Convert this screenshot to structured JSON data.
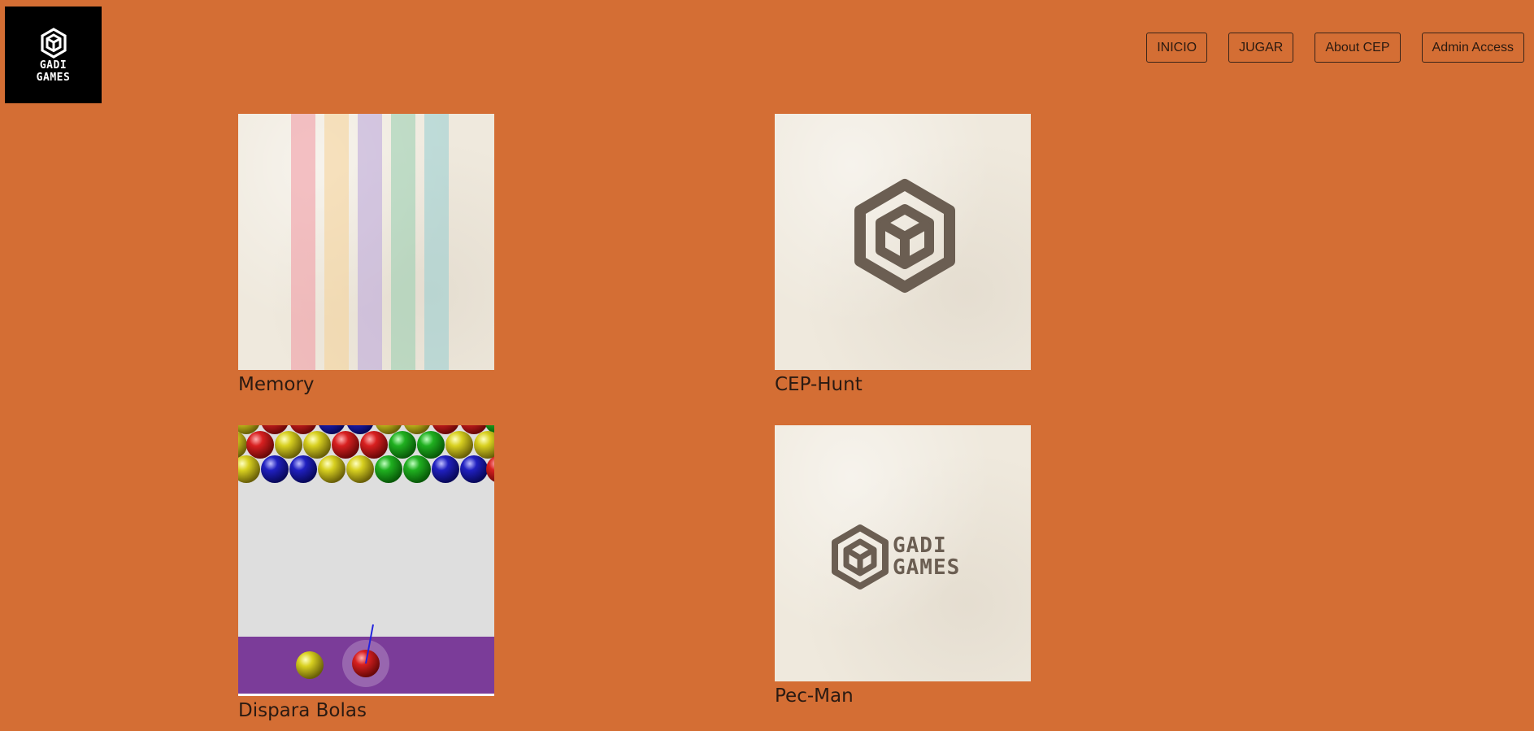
{
  "logo": {
    "line1": "GADI",
    "line2": "GAMES"
  },
  "nav": {
    "inicio": "INICIO",
    "jugar": "JUGAR",
    "about": "About CEP",
    "admin": "Admin Access"
  },
  "games": {
    "memory": {
      "title": "Memory"
    },
    "cep_hunt": {
      "title": "CEP-Hunt"
    },
    "dispara_bolas": {
      "title": "Dispara Bolas"
    },
    "pec_man": {
      "title": "Pec-Man",
      "logo_line1": "GADI",
      "logo_line2": "GAMES"
    }
  },
  "colors": {
    "background": "#D46E34",
    "logo_bg": "#000000",
    "paper": "#EFE9DD",
    "logo_mark": "#6B5E52"
  }
}
